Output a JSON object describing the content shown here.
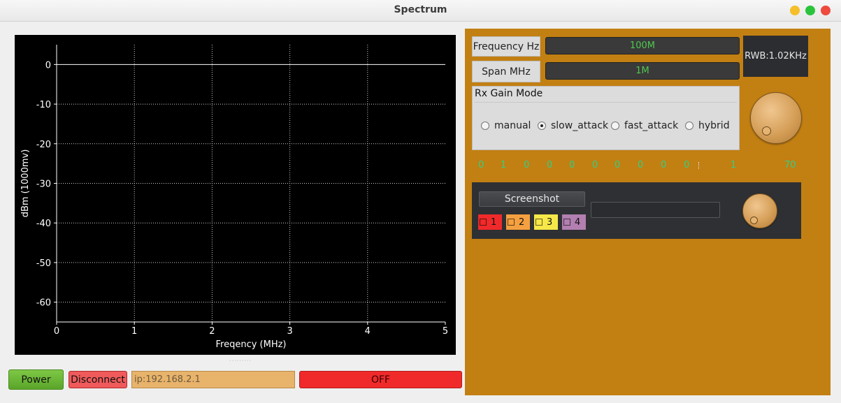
{
  "window": {
    "title": "Spectrum"
  },
  "chart_data": {
    "type": "line",
    "xlabel": "Freqency (MHz)",
    "ylabel": "dBm (1000mv)",
    "xlim": [
      0,
      5
    ],
    "ylim": [
      -65,
      5
    ],
    "x_ticks": [
      "0",
      "1",
      "2",
      "3",
      "4",
      "5"
    ],
    "y_ticks": [
      "0",
      "-10",
      "-20",
      "-30",
      "-40",
      "-50",
      "-60"
    ],
    "grid": true,
    "series": [
      {
        "x": [
          0,
          5
        ],
        "y": [
          0,
          0
        ]
      }
    ]
  },
  "bottom": {
    "power_label": "Power",
    "disconnect_label": "Disconnect",
    "ip_value": "ip:192.168.2.1",
    "status_label": "OFF"
  },
  "settings": {
    "frequency_label": "Frequency Hz",
    "frequency_value": "100M",
    "span_label": "Span MHz",
    "span_value": "1M",
    "rwb": "RWB:1.02KHz",
    "gain_mode_title": "Rx Gain Mode",
    "gain_modes": [
      {
        "label": "manual",
        "checked": false
      },
      {
        "label": "slow_attack",
        "checked": true
      },
      {
        "label": "fast_attack",
        "checked": false
      },
      {
        "label": "hybrid",
        "checked": false
      }
    ],
    "gain_digits": [
      "0",
      "1",
      "0",
      "0",
      "0",
      "0",
      "0",
      "0",
      "0",
      "0"
    ],
    "gain_value": "1",
    "gain_max": "70"
  },
  "capture": {
    "screenshot_label": "Screenshot",
    "channels": [
      {
        "label": "1",
        "color": "#f02a2a"
      },
      {
        "label": "2",
        "color": "#f5a040"
      },
      {
        "label": "3",
        "color": "#f7e84a"
      },
      {
        "label": "4",
        "color": "#b27fb0"
      }
    ]
  }
}
